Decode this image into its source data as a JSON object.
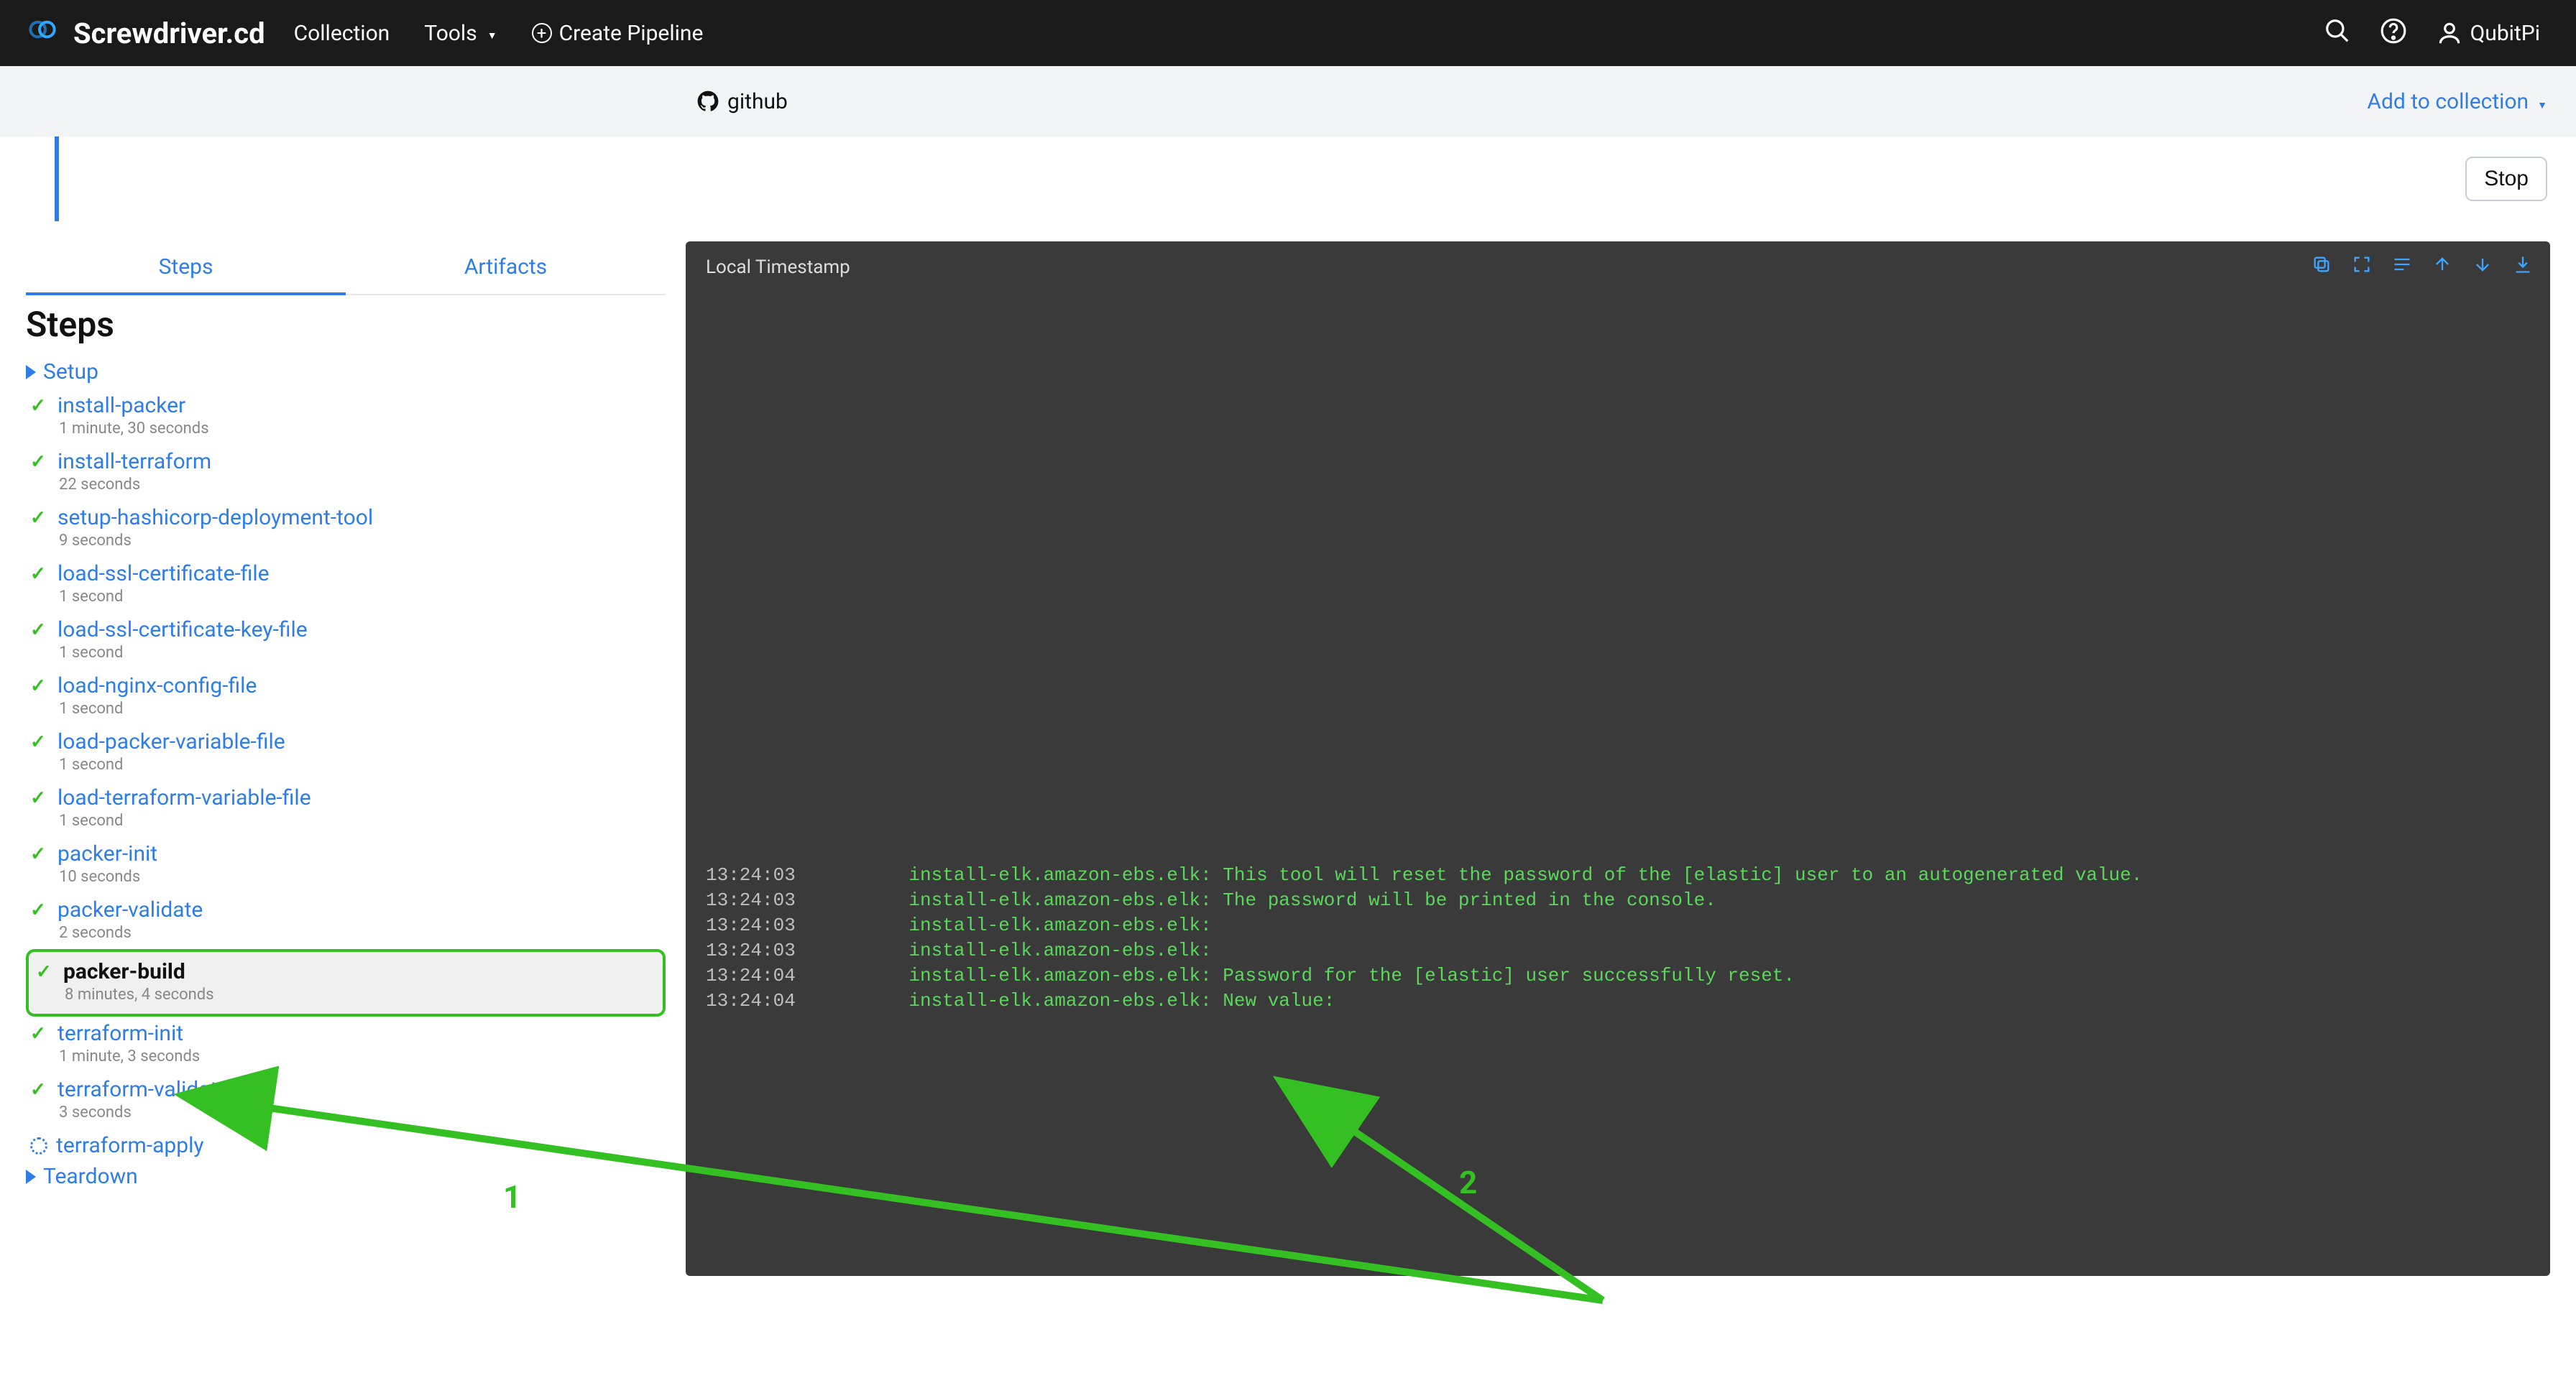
{
  "brand": {
    "name": "Screwdriver.cd"
  },
  "nav": {
    "collection": "Collection",
    "tools": "Tools",
    "create_pipeline": "Create Pipeline"
  },
  "user": {
    "name": "QubitPi"
  },
  "subheader": {
    "provider": "github",
    "add_to_collection": "Add to collection"
  },
  "statusbar": {
    "stop": "Stop"
  },
  "tabs": {
    "steps": "Steps",
    "artifacts": "Artifacts"
  },
  "steps_title": "Steps",
  "groups": {
    "setup": "Setup",
    "teardown": "Teardown"
  },
  "steps": [
    {
      "name": "install-packer",
      "duration": "1 minute, 30 seconds",
      "status": "ok"
    },
    {
      "name": "install-terraform",
      "duration": "22 seconds",
      "status": "ok"
    },
    {
      "name": "setup-hashicorp-deployment-tool",
      "duration": "9 seconds",
      "status": "ok"
    },
    {
      "name": "load-ssl-certificate-file",
      "duration": "1 second",
      "status": "ok"
    },
    {
      "name": "load-ssl-certificate-key-file",
      "duration": "1 second",
      "status": "ok"
    },
    {
      "name": "load-nginx-config-file",
      "duration": "1 second",
      "status": "ok"
    },
    {
      "name": "load-packer-variable-file",
      "duration": "1 second",
      "status": "ok"
    },
    {
      "name": "load-terraform-variable-file",
      "duration": "1 second",
      "status": "ok"
    },
    {
      "name": "packer-init",
      "duration": "10 seconds",
      "status": "ok"
    },
    {
      "name": "packer-validate",
      "duration": "2 seconds",
      "status": "ok"
    },
    {
      "name": "packer-build",
      "duration": "8 minutes, 4 seconds",
      "status": "ok",
      "selected": true
    },
    {
      "name": "terraform-init",
      "duration": "1 minute, 3 seconds",
      "status": "ok"
    },
    {
      "name": "terraform-validate",
      "duration": "3 seconds",
      "status": "ok"
    },
    {
      "name": "terraform-apply",
      "duration": "",
      "status": "running"
    }
  ],
  "log": {
    "header": "Local Timestamp",
    "lines": [
      {
        "ts": "13:24:03",
        "msg": "install-elk.amazon-ebs.elk: This tool will reset the password of the [elastic] user to an autogenerated value."
      },
      {
        "ts": "13:24:03",
        "msg": "install-elk.amazon-ebs.elk: The password will be printed in the console."
      },
      {
        "ts": "13:24:03",
        "msg": "install-elk.amazon-ebs.elk:"
      },
      {
        "ts": "13:24:03",
        "msg": "install-elk.amazon-ebs.elk:"
      },
      {
        "ts": "13:24:04",
        "msg": "install-elk.amazon-ebs.elk: Password for the [elastic] user successfully reset."
      },
      {
        "ts": "13:24:04",
        "msg": "install-elk.amazon-ebs.elk: New value:"
      }
    ]
  },
  "annotations": {
    "one": "1",
    "two": "2"
  }
}
